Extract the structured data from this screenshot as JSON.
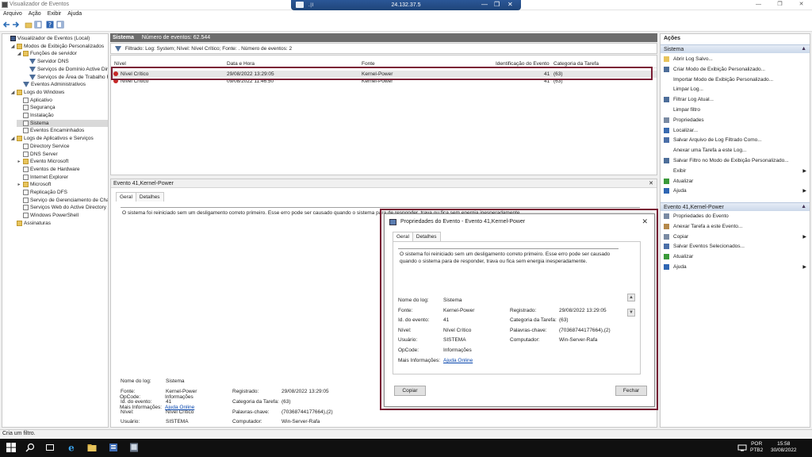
{
  "window": {
    "title": "Visualizador de Eventos",
    "controls": [
      "—",
      "❐",
      "✕"
    ]
  },
  "rdp": {
    "ip": "24.132.37.5",
    "signal": ".∣l",
    "controls": [
      "—",
      "❐",
      "✕"
    ]
  },
  "menu": [
    "Arquivo",
    "Ação",
    "Exibir",
    "Ajuda"
  ],
  "tree": [
    {
      "label": "Visualizador de Eventos (Local)",
      "depth": 0,
      "icon": "root",
      "exp": ""
    },
    {
      "label": "Modos de Exibição Personalizados",
      "depth": 1,
      "icon": "folder",
      "exp": "◢"
    },
    {
      "label": "Funções de servidor",
      "depth": 2,
      "icon": "folder",
      "exp": "◢"
    },
    {
      "label": "Servidor DNS",
      "depth": 3,
      "icon": "filter",
      "exp": ""
    },
    {
      "label": "Serviços de Domínio Active Directory",
      "depth": 3,
      "icon": "filter",
      "exp": ""
    },
    {
      "label": "Serviços de Área de Trabalho Remota",
      "depth": 3,
      "icon": "filter",
      "exp": ""
    },
    {
      "label": "Eventos Administrativos",
      "depth": 2,
      "icon": "filter",
      "exp": ""
    },
    {
      "label": "Logs do Windows",
      "depth": 1,
      "icon": "folder",
      "exp": "◢"
    },
    {
      "label": "Aplicativo",
      "depth": 2,
      "icon": "log",
      "exp": ""
    },
    {
      "label": "Segurança",
      "depth": 2,
      "icon": "log",
      "exp": ""
    },
    {
      "label": "Instalação",
      "depth": 2,
      "icon": "log",
      "exp": ""
    },
    {
      "label": "Sistema",
      "depth": 2,
      "icon": "log",
      "exp": "",
      "selected": true
    },
    {
      "label": "Eventos Encaminhados",
      "depth": 2,
      "icon": "log",
      "exp": ""
    },
    {
      "label": "Logs de Aplicativos e Serviços",
      "depth": 1,
      "icon": "folder",
      "exp": "◢"
    },
    {
      "label": "Directory Service",
      "depth": 2,
      "icon": "log",
      "exp": ""
    },
    {
      "label": "DNS Server",
      "depth": 2,
      "icon": "log",
      "exp": ""
    },
    {
      "label": "Evento Microsoft",
      "depth": 2,
      "icon": "folder",
      "exp": "▸"
    },
    {
      "label": "Eventos de Hardware",
      "depth": 2,
      "icon": "log",
      "exp": ""
    },
    {
      "label": "Internet Explorer",
      "depth": 2,
      "icon": "log",
      "exp": ""
    },
    {
      "label": "Microsoft",
      "depth": 2,
      "icon": "folder",
      "exp": "▸"
    },
    {
      "label": "Replicação DFS",
      "depth": 2,
      "icon": "log",
      "exp": ""
    },
    {
      "label": "Serviço de Gerenciamento de Chaves",
      "depth": 2,
      "icon": "log",
      "exp": ""
    },
    {
      "label": "Serviços Web do Active Directory",
      "depth": 2,
      "icon": "log",
      "exp": ""
    },
    {
      "label": "Windows PowerShell",
      "depth": 2,
      "icon": "log",
      "exp": ""
    },
    {
      "label": "Assinaturas",
      "depth": 1,
      "icon": "folder",
      "exp": ""
    }
  ],
  "grid": {
    "log_name": "Sistema",
    "count": "Número de eventos: 62.544",
    "filter": "Filtrado: Log: System; Nível: Nível Crítico; Fonte: . Número de eventos: 2",
    "columns": [
      "Nível",
      "Data e Hora",
      "Fonte",
      "Identificação do Evento",
      "Categoria da Tarefa"
    ],
    "rows": [
      {
        "level": "Nível Crítico",
        "datetime": "29/08/2022 13:29:05",
        "source": "Kernel-Power",
        "id": "41",
        "task": "(63)",
        "selected": true
      },
      {
        "level": "Nível Crítico",
        "datetime": "09/08/2022 11:46:50",
        "source": "Kernel-Power",
        "id": "41",
        "task": "(63)"
      }
    ]
  },
  "detail": {
    "title": "Evento 41,Kernel-Power",
    "close": "✕",
    "tabs": [
      "Geral",
      "Detalhes"
    ],
    "description": "O sistema foi reiniciado sem um desligamento correto primeiro. Esse erro pode ser causado quando o sistema para de responder, trava ou fica sem energia inesperadamente.",
    "fields": {
      "log_name_label": "Nome do log:",
      "log_name": "Sistema",
      "source_label": "Fonte:",
      "source": "Kernel-Power",
      "logged_label": "Registrado:",
      "logged": "29/08/2022 13:29:05",
      "event_id_label": "Id. do evento:",
      "event_id": "41",
      "task_label": "Categoria da Tarefa:",
      "task": "(63)",
      "level_label": "Nível:",
      "level": "Nível Crítico",
      "keywords_label": "Palavras-chave:",
      "keywords": "(70368744177664),(2)",
      "user_label": "Usuário:",
      "user": "SISTEMA",
      "computer_label": "Computador:",
      "computer": "Win-Server-Rafa",
      "opcode_label": "OpCode:",
      "opcode": "Informações",
      "more_label": "Mais Informações:",
      "more_link": "Ajuda Online"
    }
  },
  "dialog": {
    "title": "Propriedades do Evento - Evento 41,Kernel-Power",
    "close": "✕",
    "tabs": [
      "Geral",
      "Detalhes"
    ],
    "description": "O sistema foi reiniciado sem um desligamento correto primeiro. Esse erro pode ser causado quando o sistema para de responder, trava ou fica sem energia inesperadamente.",
    "fields": {
      "log_name_label": "Nome do log:",
      "log_name": "Sistema",
      "source_label": "Fonte:",
      "source": "Kernel-Power",
      "logged_label": "Registrado:",
      "logged": "29/08/2022 13:29:05",
      "event_id_label": "Id. do evento:",
      "event_id": "41",
      "task_label": "Categoria da Tarefa:",
      "task": "(63)",
      "level_label": "Nível:",
      "level": "Nível Crítico",
      "keywords_label": "Palavras-chave:",
      "keywords": "(70368744177664),(2)",
      "user_label": "Usuário:",
      "user": "SISTEMA",
      "computer_label": "Computador:",
      "computer": "Win-Server-Rafa",
      "opcode_label": "OpCode:",
      "opcode": "Informações",
      "more_label": "Mais Informações:",
      "more_link": "Ajuda Online"
    },
    "copy_button": "Copiar",
    "close_button": "Fechar",
    "scroll_up": "▲",
    "scroll_down": "▼"
  },
  "actions": {
    "title": "Ações",
    "section1": "Sistema",
    "section1_items": [
      {
        "label": "Abrir Log Salvo...",
        "icon": "folder-open-icon",
        "color": "#e8c45c"
      },
      {
        "label": "Criar Modo de Exibição Personalizado...",
        "icon": "filter-icon",
        "color": "#4d6e9a"
      },
      {
        "label": "Importar Modo de Exibição Personalizado...",
        "icon": "",
        "color": ""
      },
      {
        "label": "Limpar Log...",
        "icon": "",
        "color": ""
      },
      {
        "label": "Filtrar Log Atual...",
        "icon": "filter-icon",
        "color": "#4d6e9a"
      },
      {
        "label": "Limpar filtro",
        "icon": "",
        "color": ""
      },
      {
        "label": "Propriedades",
        "icon": "properties-icon",
        "color": "#7a8ba3"
      },
      {
        "label": "Localizar...",
        "icon": "find-icon",
        "color": "#3a6bb0"
      },
      {
        "label": "Salvar Arquivo de Log Filtrado Como...",
        "icon": "save-icon",
        "color": "#4b6fa8"
      },
      {
        "label": "Anexar uma Tarefa a este Log...",
        "icon": "",
        "color": ""
      },
      {
        "label": "Salvar Filtro no Modo de Exibição Personalizado...",
        "icon": "filter-icon",
        "color": "#4d6e9a"
      },
      {
        "label": "Exibir",
        "icon": "",
        "color": "",
        "sub": "▶"
      },
      {
        "label": "Atualizar",
        "icon": "refresh-icon",
        "color": "#3a9a3a"
      },
      {
        "label": "Ajuda",
        "icon": "help-icon",
        "color": "#2f66b3",
        "sub": "▶"
      }
    ],
    "section2": "Evento 41,Kernel-Power",
    "section2_items": [
      {
        "label": "Propriedades do Evento",
        "icon": "event-properties-icon",
        "color": "#7a8ba3"
      },
      {
        "label": "Anexar Tarefa a este Evento...",
        "icon": "task-icon",
        "color": "#b5894a"
      },
      {
        "label": "Copiar",
        "icon": "copy-icon",
        "color": "#7a8ba3",
        "sub": "▶"
      },
      {
        "label": "Salvar Eventos Selecionados...",
        "icon": "save-icon",
        "color": "#4b6fa8"
      },
      {
        "label": "Atualizar",
        "icon": "refresh-icon",
        "color": "#3a9a3a"
      },
      {
        "label": "Ajuda",
        "icon": "help-icon",
        "color": "#2f66b3",
        "sub": "▶"
      }
    ],
    "collapse": "▲"
  },
  "status": "Cria um filtro.",
  "taskbar": {
    "lang": "POR",
    "lang2": "PTB2",
    "time": "15:58",
    "date": "30/08/2022"
  },
  "colors": {
    "highlight": "#7b1e35",
    "critical": "#c62828",
    "link": "#0645ad"
  }
}
